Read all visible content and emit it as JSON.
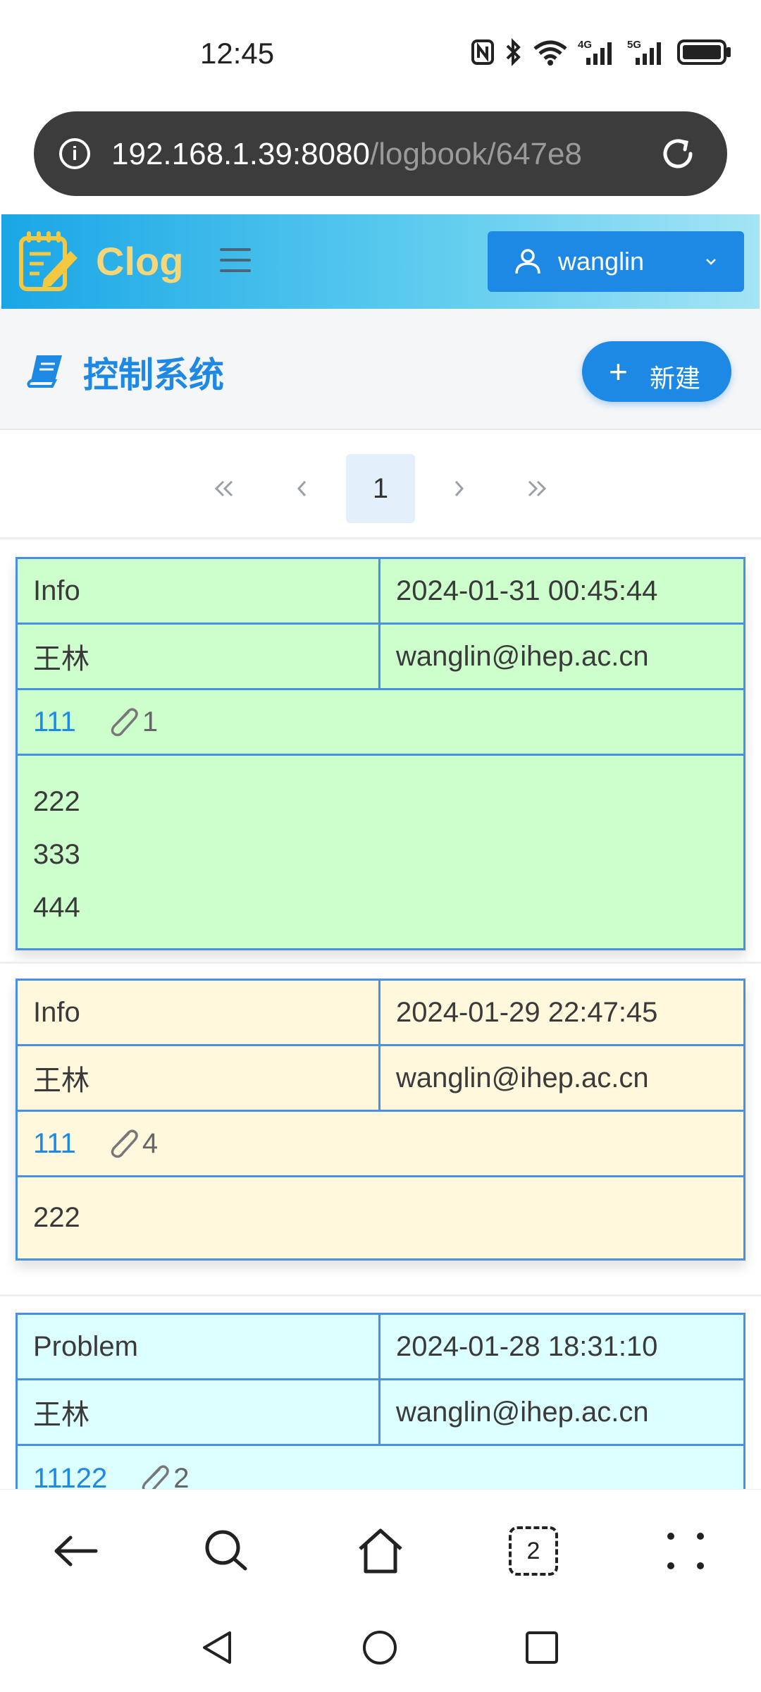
{
  "status_bar": {
    "time": "12:45",
    "network_4g": "4G",
    "network_5g": "5G"
  },
  "browser": {
    "url_host": "192.168.1.39:8080",
    "url_path": "/logbook/647e8"
  },
  "header": {
    "app_name": "Clog",
    "user_name": "wanglin"
  },
  "titlebar": {
    "title": "控制系统",
    "new_button_label": "新建"
  },
  "pagination": {
    "first": "«",
    "prev": "‹",
    "current": "1",
    "next": "›",
    "last": "»"
  },
  "entries": [
    {
      "type": "Info",
      "datetime": "2024-01-31 00:45:44",
      "author": "王林",
      "email": "wanglin@ihep.ac.cn",
      "title": "111",
      "attachments": "1",
      "body": [
        "222",
        "333",
        "444"
      ],
      "color": "#ccffcc"
    },
    {
      "type": "Info",
      "datetime": "2024-01-29 22:47:45",
      "author": "王林",
      "email": "wanglin@ihep.ac.cn",
      "title": "111",
      "attachments": "4",
      "body": [
        "222"
      ],
      "color": "#fff8dc"
    },
    {
      "type": "Problem",
      "datetime": "2024-01-28 18:31:10",
      "author": "王林",
      "email": "wanglin@ihep.ac.cn",
      "title": "11122",
      "attachments": "2",
      "body": [],
      "color": "#dcffff"
    }
  ],
  "browser_nav": {
    "tab_count": "2"
  },
  "colors": {
    "accent": "#1e88e5",
    "border": "#4a90e2"
  }
}
